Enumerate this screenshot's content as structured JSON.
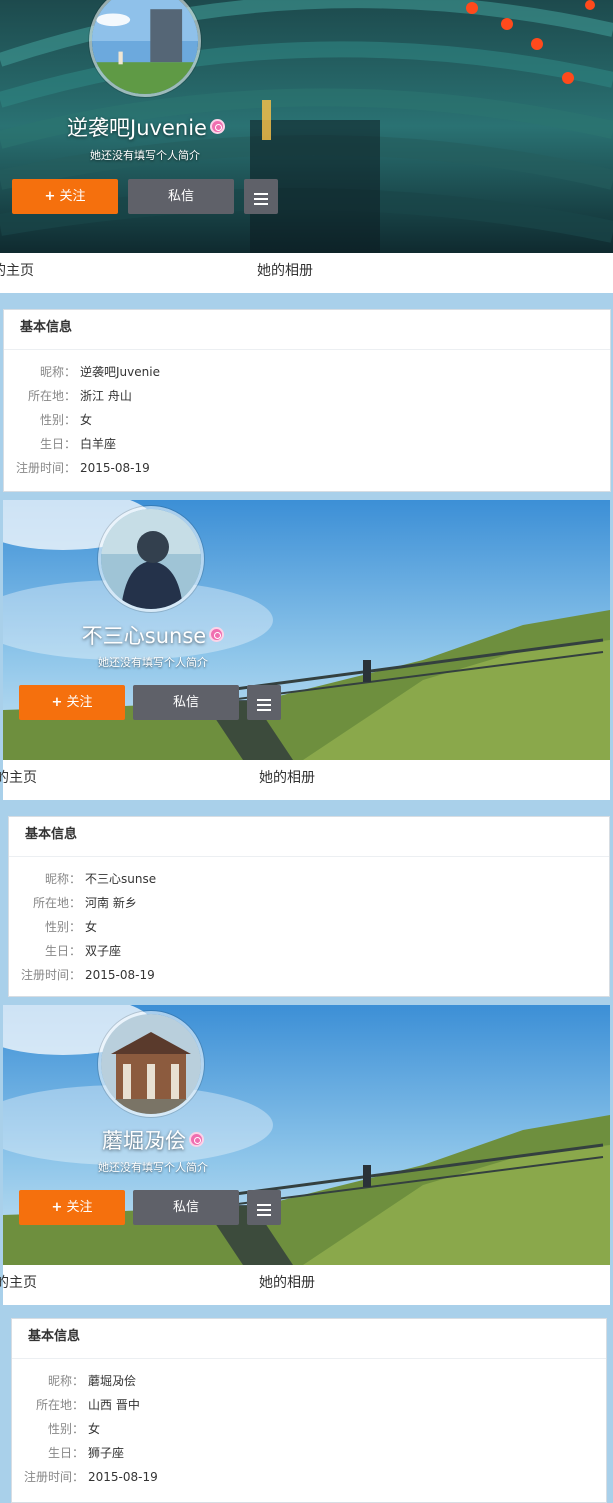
{
  "actions": {
    "follow_label": "关注",
    "follow_prefix": "+",
    "message_label": "私信"
  },
  "tabs": {
    "home": "的主页",
    "album": "她的相册"
  },
  "panel_title": "基本信息",
  "labels": {
    "nickname": "昵称：",
    "location": "所在地：",
    "gender": "性别：",
    "birthday": "生日：",
    "register": "注册时间："
  },
  "profiles": [
    {
      "name": "逆袭吧Juvenie",
      "intro": "她还没有填写个人简介",
      "nickname": "逆袭吧Juvenie",
      "location": "浙江 舟山",
      "gender": "女",
      "birthday": "白羊座",
      "register": "2015-08-19"
    },
    {
      "name": "不三心sunse",
      "intro": "她还没有填写个人简介",
      "nickname": "不三心sunse",
      "location": "河南 新乡",
      "gender": "女",
      "birthday": "双子座",
      "register": "2015-08-19"
    },
    {
      "name": "蘑堀夃侩",
      "intro": "她还没有填写个人简介",
      "nickname": "蘑堀夃侩",
      "location": "山西 晋中",
      "gender": "女",
      "birthday": "狮子座",
      "register": "2015-08-19"
    }
  ],
  "icons": {
    "badge": "search-badge-icon",
    "more": "menu-icon"
  },
  "colors": {
    "follow": "#f5700d",
    "secondary": "#5f6169",
    "badge": "#f06eb0",
    "page_bg": "#a9d0ea"
  }
}
